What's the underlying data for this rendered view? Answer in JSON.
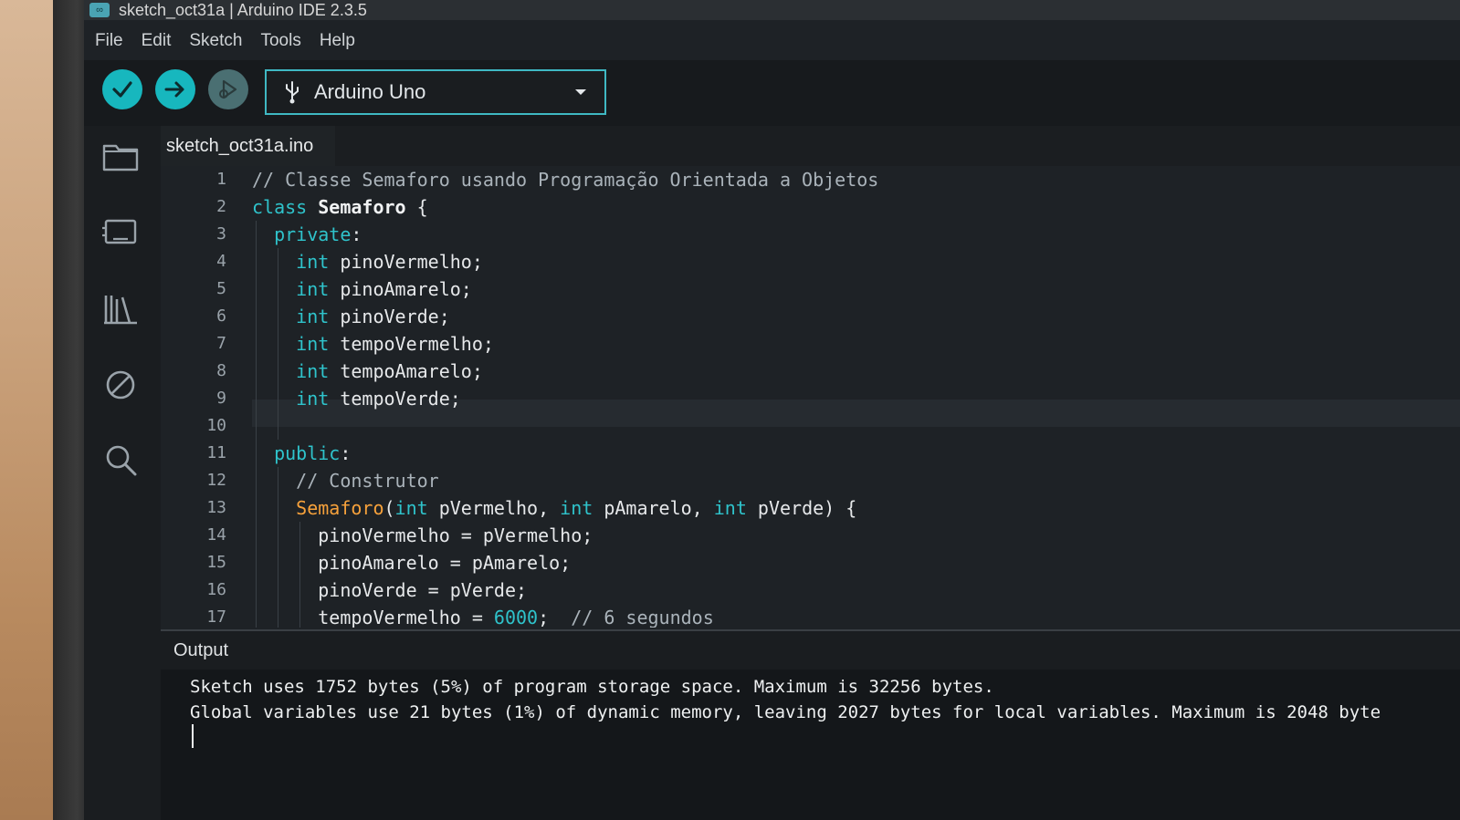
{
  "window": {
    "title": "sketch_oct31a | Arduino IDE 2.3.5"
  },
  "menu": [
    "File",
    "Edit",
    "Sketch",
    "Tools",
    "Help"
  ],
  "toolbar": {
    "board": "Arduino Uno"
  },
  "tabs": [
    {
      "label": "sketch_oct31a.ino",
      "active": true
    }
  ],
  "editor": {
    "line_numbers": [
      "1",
      "2",
      "3",
      "4",
      "5",
      "6",
      "7",
      "8",
      "9",
      "10",
      "11",
      "12",
      "13",
      "14",
      "15",
      "16",
      "17"
    ],
    "lines": [
      "// Classe Semaforo usando Programação Orientada a Objetos",
      "class Semaforo {",
      "  private:",
      "    int pinoVermelho;",
      "    int pinoAmarelo;",
      "    int pinoVerde;",
      "    int tempoVermelho;",
      "    int tempoAmarelo;",
      "    int tempoVerde;",
      "",
      "  public:",
      "    // Construtor",
      "    Semaforo(int pVermelho, int pAmarelo, int pVerde) {",
      "      pinoVermelho = pVermelho;",
      "      pinoAmarelo = pAmarelo;",
      "      pinoVerde = pVerde;",
      "      tempoVermelho = 6000;  // 6 segundos"
    ],
    "highlighted_line": 9
  },
  "output": {
    "title": "Output",
    "lines": [
      "Sketch uses 1752 bytes (5%) of program storage space. Maximum is 32256 bytes.",
      "Global variables use 21 bytes (1%) of dynamic memory, leaving 2027 bytes for local variables. Maximum is 2048 byte"
    ]
  },
  "colors": {
    "accent": "#17b7be",
    "keyword": "#2fc3cb",
    "function": "#f6a13b",
    "comment": "#aab3ba"
  }
}
